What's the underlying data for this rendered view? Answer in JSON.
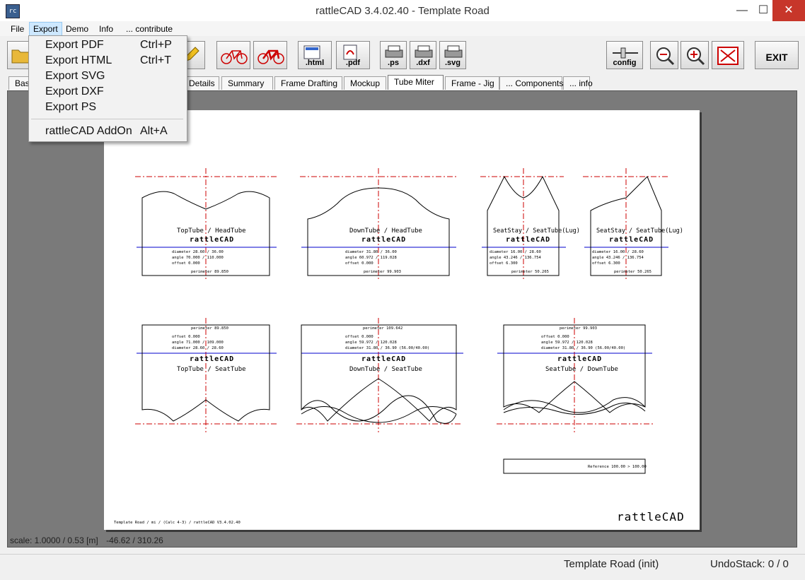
{
  "window": {
    "title": "rattleCAD  3.4.02.40 - Template Road",
    "icon_label": "rc",
    "minimize": "—",
    "maximize": "☐",
    "close": "✕"
  },
  "menubar": [
    "File",
    "Export",
    "Demo",
    "Info",
    "... contribute"
  ],
  "export_menu": {
    "items": [
      {
        "label": "Export PDF",
        "shortcut": "Ctrl+P"
      },
      {
        "label": "Export HTML",
        "shortcut": "Ctrl+T"
      },
      {
        "label": "Export SVG",
        "shortcut": ""
      },
      {
        "label": "Export DXF",
        "shortcut": ""
      },
      {
        "label": "Export PS",
        "shortcut": ""
      }
    ],
    "addon": {
      "label": "rattleCAD AddOn",
      "shortcut": "Alt+A"
    }
  },
  "toolbar": {
    "html": ".html",
    "pdf": ".pdf",
    "ps": ".ps",
    "dxf": ".dxf",
    "svg": ".svg",
    "config": "config",
    "exit": "EXIT"
  },
  "tabs": [
    "Bas",
    "Details",
    "Summary",
    "Frame Drafting",
    "Mockup",
    "Tube Miter",
    "Frame - Jig",
    "... Components",
    "... info"
  ],
  "active_tab": "Tube Miter",
  "status": {
    "scale": "scale: 1.0000 / 0.53  [m]",
    "coords": "-46.62 / 310.26",
    "template": "Template Road (init)",
    "undo": "UndoStack:  0 /  0"
  },
  "drawing": {
    "logo": "rattleCAD",
    "footer": "Template Road  /  mi  /  (Calc 4-3)  /  rattleCAD  V3.4.02.40",
    "panels": [
      {
        "caption": "TopTube  /  HeadTube",
        "rows": [
          "diameter  28.60 / 36.00",
          "angle  70.000 / 110.000",
          "offset  0.000"
        ],
        "perimeter": "perimeter  89.850"
      },
      {
        "caption": "DownTube  /  HeadTube",
        "rows": [
          "diameter  31.80 / 36.00",
          "angle  60.972 / 119.028",
          "offset  0.000"
        ],
        "perimeter": "perimeter  99.903"
      },
      {
        "caption": "SeatStay  /  SeatTube(Lug)",
        "rows": [
          "diameter  16.00 / 28.60",
          "angle  43.246 / 136.754",
          "offset  6.300"
        ],
        "perimeter": "perimeter  50.265"
      },
      {
        "caption": "SeatStay  /  SeatTube(Lug)",
        "rows": [
          "diameter  16.00 / 28.60",
          "angle  43.246 / 136.754",
          "offset  6.300"
        ],
        "perimeter": "perimeter  50.265"
      },
      {
        "caption": "TopTube  /  SeatTube",
        "rows": [
          "offset  0.000",
          "angle  71.000 / 109.000",
          "diameter  28.60 / 28.60"
        ],
        "perimeter": "perimeter  89.850"
      },
      {
        "caption": "DownTube  /  SeatTube",
        "rows": [
          "offset  0.000",
          "angle  59.972 / 120.028",
          "diameter  31.80 / 36.90  (56.00/40.00)"
        ],
        "perimeter": "perimeter  109.642"
      },
      {
        "caption": "SeatTube  /  DownTube",
        "rows": [
          "offset  0.000",
          "angle  59.972 / 120.028",
          "diameter  31.80 / 36.90  (56.00/40.00)"
        ],
        "perimeter": "perimeter  99.903"
      }
    ],
    "reference": "Reference  100.00  >  100.00"
  },
  "colors": {
    "center_line": "#cc0000",
    "axis_line": "#0000cc",
    "close_button": "#c7362a",
    "active_menu": "#cde8ff"
  }
}
